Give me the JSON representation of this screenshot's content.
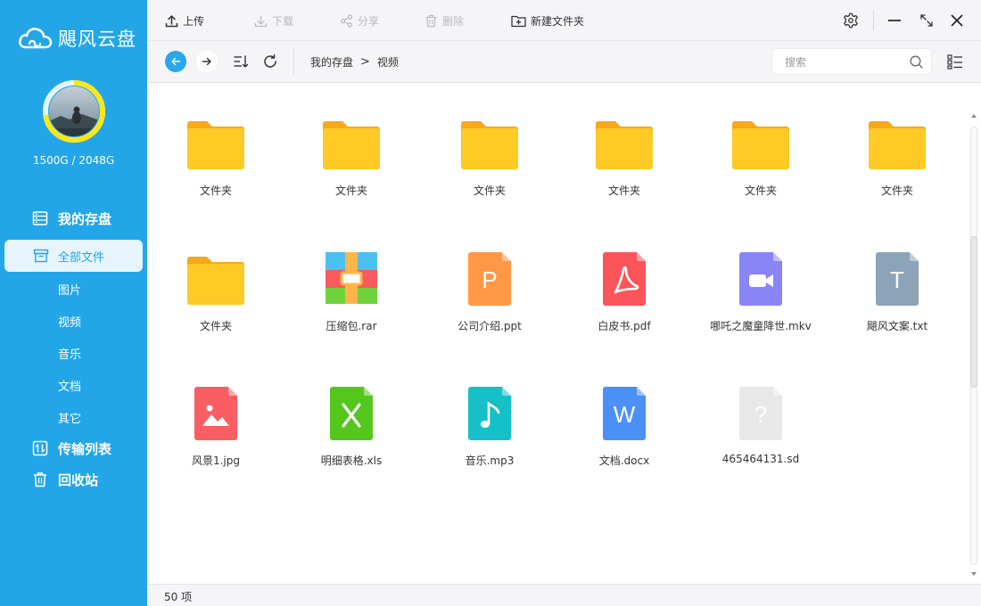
{
  "app": {
    "name": "飓风云盘",
    "storage": "1500G / 2048G",
    "storage_used_fraction": 0.73
  },
  "sidebar": {
    "groups": {
      "my_disk": "我的存盘",
      "transfer": "传输列表",
      "recycle": "回收站"
    },
    "active_item": "全部文件",
    "sub_items": [
      "图片",
      "视频",
      "音乐",
      "文档",
      "其它"
    ]
  },
  "toolbar": {
    "upload": "上传",
    "download": "下载",
    "share": "分享",
    "delete": "删除",
    "new_folder": "新建文件夹"
  },
  "navbar": {
    "breadcrumb": [
      "我的存盘",
      "视频"
    ],
    "breadcrumb_separator": ">",
    "search_placeholder": "搜索"
  },
  "files": [
    {
      "name": "文件夹",
      "type": "folder"
    },
    {
      "name": "文件夹",
      "type": "folder"
    },
    {
      "name": "文件夹",
      "type": "folder"
    },
    {
      "name": "文件夹",
      "type": "folder"
    },
    {
      "name": "文件夹",
      "type": "folder"
    },
    {
      "name": "文件夹",
      "type": "folder"
    },
    {
      "name": "文件夹",
      "type": "folder"
    },
    {
      "name": "压缩包.rar",
      "type": "rar"
    },
    {
      "name": "公司介绍.ppt",
      "type": "ppt",
      "glyph": "P"
    },
    {
      "name": "白皮书.pdf",
      "type": "pdf"
    },
    {
      "name": "哪吒之魔童降世.mkv",
      "type": "video"
    },
    {
      "name": "飓风文案.txt",
      "type": "txt",
      "glyph": "T"
    },
    {
      "name": "风景1.jpg",
      "type": "image"
    },
    {
      "name": "明细表格.xls",
      "type": "xls",
      "glyph": "X"
    },
    {
      "name": "音乐.mp3",
      "type": "audio"
    },
    {
      "name": "文档.docx",
      "type": "doc",
      "glyph": "W"
    },
    {
      "name": "465464131.sd",
      "type": "unknown",
      "glyph": "?"
    }
  ],
  "colors": {
    "sidebar": "#22a6e8",
    "folder": "#ffc926",
    "folder_tab": "#f7a81b",
    "ppt": "#ff9846",
    "pdf": "#fb5559",
    "video": "#8a85f6",
    "txt": "#8da3b8",
    "image": "#f85e62",
    "xls": "#54c71c",
    "audio": "#16c0c8",
    "doc": "#4a90f5",
    "unknown": "#e8e8e8"
  },
  "status": {
    "count": "50 项"
  }
}
